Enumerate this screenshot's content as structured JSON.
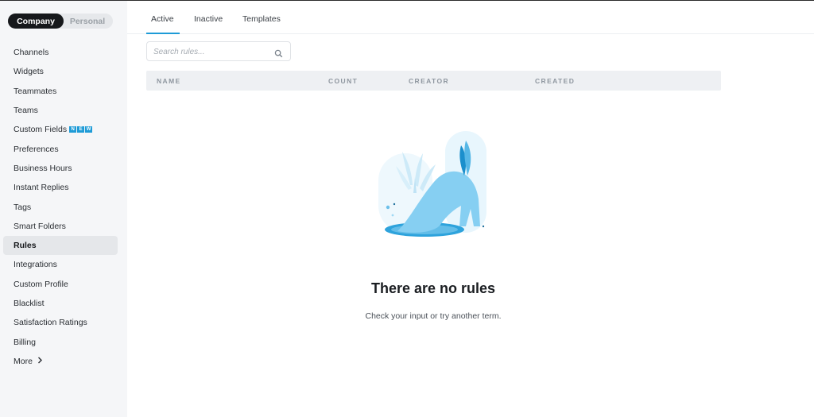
{
  "scope_toggle": {
    "company": "Company",
    "personal": "Personal"
  },
  "sidebar": {
    "items": [
      {
        "label": "Channels"
      },
      {
        "label": "Widgets"
      },
      {
        "label": "Teammates"
      },
      {
        "label": "Teams"
      },
      {
        "label": "Custom Fields",
        "badge": "NEW"
      },
      {
        "label": "Preferences"
      },
      {
        "label": "Business Hours"
      },
      {
        "label": "Instant Replies"
      },
      {
        "label": "Tags"
      },
      {
        "label": "Smart Folders"
      },
      {
        "label": "Rules",
        "selected": true
      },
      {
        "label": "Integrations"
      },
      {
        "label": "Custom Profile"
      },
      {
        "label": "Blacklist"
      },
      {
        "label": "Satisfaction Ratings"
      },
      {
        "label": "Billing"
      },
      {
        "label": "More",
        "icon": "chevron-right-icon"
      }
    ]
  },
  "tabs": [
    {
      "label": "Active",
      "active": true
    },
    {
      "label": "Inactive"
    },
    {
      "label": "Templates"
    }
  ],
  "search": {
    "placeholder": "Search rules...",
    "value": ""
  },
  "table": {
    "columns": [
      "NAME",
      "COUNT",
      "CREATOR",
      "CREATED"
    ]
  },
  "empty_state": {
    "title": "There are no rules",
    "subtitle": "Check your input or try another term."
  },
  "colors": {
    "accent": "#1e9bd7",
    "toggle_active_bg": "#16181b",
    "sidebar_bg": "#f5f6f8",
    "illustration_blue": "#7ccbf2"
  }
}
